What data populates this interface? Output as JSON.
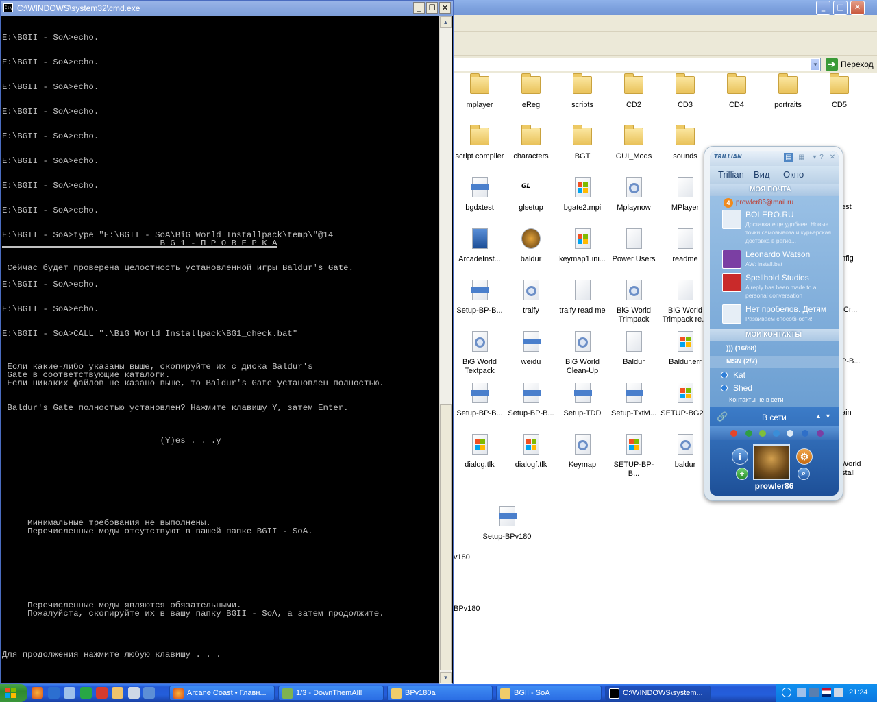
{
  "explorer": {
    "go_label": "Переход",
    "files": [
      {
        "label": "mplayer",
        "icon": "folder-icon"
      },
      {
        "label": "eReg",
        "icon": "folder-icon"
      },
      {
        "label": "scripts",
        "icon": "folder-icon"
      },
      {
        "label": "CD2",
        "icon": "folder-icon"
      },
      {
        "label": "CD3",
        "icon": "folder-icon"
      },
      {
        "label": "CD4",
        "icon": "folder-icon"
      },
      {
        "label": "portraits",
        "icon": "folder-icon"
      },
      {
        "label": "CD5",
        "icon": "folder-icon"
      },
      {
        "label": "script compiler",
        "icon": "folder-icon"
      },
      {
        "label": "characters",
        "icon": "folder-icon"
      },
      {
        "label": "BGT",
        "icon": "folder-icon"
      },
      {
        "label": "GUI_Mods",
        "icon": "folder-icon"
      },
      {
        "label": "sounds",
        "icon": "folder-icon"
      },
      {
        "label": "bgdxtest",
        "icon": "app-icon"
      },
      {
        "label": "glsetup",
        "icon": "opengl-icon"
      },
      {
        "label": "bgate2.mpi",
        "icon": "windows-file-icon"
      },
      {
        "label": "Mplaynow",
        "icon": "settings-file-icon"
      },
      {
        "label": "MPlayer",
        "icon": "document-icon"
      },
      {
        "label": "ArcadeInst...",
        "icon": "installer-icon"
      },
      {
        "label": "baldur",
        "icon": "baldur-icon"
      },
      {
        "label": "keymap1.ini...",
        "icon": "windows-file-icon"
      },
      {
        "label": "Power Users",
        "icon": "document-icon"
      },
      {
        "label": "readme",
        "icon": "document-icon"
      },
      {
        "label": "Setup-BP-B...",
        "icon": "app-icon"
      },
      {
        "label": "traify",
        "icon": "settings-file-icon"
      },
      {
        "label": "traify read me",
        "icon": "document-icon"
      },
      {
        "label": "BiG World Trimpack",
        "icon": "settings-file-icon"
      },
      {
        "label": "BiG World Trimpack re...",
        "icon": "document-icon"
      },
      {
        "label": "BiG World Textpack",
        "icon": "settings-file-icon"
      },
      {
        "label": "weidu",
        "icon": "app-icon"
      },
      {
        "label": "BiG World Clean-Up",
        "icon": "settings-file-icon"
      },
      {
        "label": "Baldur",
        "icon": "document-icon"
      },
      {
        "label": "Baldur.err",
        "icon": "windows-file-icon"
      },
      {
        "label": "Setup-BP-B...",
        "icon": "app-icon"
      },
      {
        "label": "Setup-BP-B...",
        "icon": "app-icon"
      },
      {
        "label": "Setup-TDD",
        "icon": "app-icon"
      },
      {
        "label": "Setup-TxtM...",
        "icon": "app-icon"
      },
      {
        "label": "SETUP-BG2...",
        "icon": "windows-file-icon"
      },
      {
        "label": "dialog.tlk",
        "icon": "windows-file-icon"
      },
      {
        "label": "dialogf.tlk",
        "icon": "windows-file-icon"
      },
      {
        "label": "Keymap",
        "icon": "settings-file-icon"
      },
      {
        "label": "SETUP-BP-B...",
        "icon": "windows-file-icon"
      },
      {
        "label": "baldur",
        "icon": "settings-file-icon"
      },
      {
        "label": "Setup-BPv180",
        "icon": "app-icon"
      }
    ],
    "partial_labels": [
      "est",
      "nfig",
      "tCr...",
      "P-B...",
      "ain",
      "World",
      "stall",
      "v180",
      "BPv180"
    ]
  },
  "trillian": {
    "logo": "TRILLIAN",
    "menu": [
      "Trillian",
      "Вид",
      "Окно"
    ],
    "section_mail": "МОЯ ПОЧТА",
    "mail_account": "prowler86@mail.ru",
    "mail_count": "4",
    "messages": [
      {
        "name": "BOLERO.RU",
        "text": "Доставка еще удобнее! Новые точки самовывоза и курьерская доставка в регио..."
      },
      {
        "name": "Leonardo Watson",
        "text": "AW: install.bat"
      },
      {
        "name": "Spellhold Studios",
        "text": "A reply has been made to a personal conversation"
      },
      {
        "name": "Нет пробелов. Детям",
        "text": "Развиваем способности!"
      }
    ],
    "section_contacts": "МОИ КОНТАКТЫ",
    "group_all": "))) (16/88)",
    "group_msn": "MSN (2/7)",
    "contacts": [
      "Kat",
      "Shed"
    ],
    "not_in_list": "Контакты не в сети",
    "status": "В сети",
    "username": "prowler86"
  },
  "cmd": {
    "title": "C:\\WINDOWS\\system32\\cmd.exe",
    "lines": [
      {
        "t": "E:\\BGII - SoA>echo."
      },
      {
        "t": "E:\\BGII - SoA>echo."
      },
      {
        "t": "E:\\BGII - SoA>echo."
      },
      {
        "t": "E:\\BGII - SoA>echo."
      },
      {
        "t": "E:\\BGII - SoA>echo."
      },
      {
        "t": "E:\\BGII - SoA>echo."
      },
      {
        "t": "E:\\BGII - SoA>echo."
      },
      {
        "t": "E:\\BGII - SoA>echo."
      },
      {
        "t": "E:\\BGII - SoA>type \"E:\\BGII - SoA\\BiG World Installpack\\temp\\\"@14"
      },
      {
        "t": "                               B G 1 - П Р О В Е Р К А"
      },
      {
        "t": " Сейчас будет проверена целостность установленной игры Baldur's Gate."
      },
      {
        "t": "E:\\BGII - SoA>echo."
      },
      {
        "t": "E:\\BGII - SoA>echo."
      },
      {
        "t": "E:\\BGII - SoA>CALL \".\\BiG World Installpack\\BG1_check.bat\""
      },
      {
        "t": " Если какие-либо указаны выше, скопируйте их с диска Baldur's"
      },
      {
        "t": " Gate в соответствующие каталоги."
      },
      {
        "t": " Если никаких файлов не казано выше, то Baldur's Gate установлен полностью."
      },
      {
        "t": " Baldur's Gate полностью установлен? Нажмите клавишу Y, затем Enter."
      },
      {
        "t": "                               (Y)es . . .y"
      },
      {
        "t": "     Минимальные требования не выполнены."
      },
      {
        "t": "     Перечисленные моды отсутствуют в вашей папке BGII - SoA."
      },
      {
        "t": "     Перечисленные моды являются обязательными."
      },
      {
        "t": "     Пожалуйста, скопируйте их в вашу папку BGII - SoA, а затем продолжите."
      },
      {
        "t": "Для продолжения нажмите любую клавишу . . ."
      }
    ]
  },
  "taskbar": {
    "start_icon": "windows-flag-icon",
    "buttons": [
      {
        "label": "Arcane Coast • Главн...",
        "icon": "firefox-icon"
      },
      {
        "label": "1/3 - DownThemAll!",
        "icon": "download-icon"
      },
      {
        "label": "BPv180a",
        "icon": "folder-icon"
      },
      {
        "label": "BGII - SoA",
        "icon": "folder-icon"
      },
      {
        "label": "C:\\WINDOWS\\system...",
        "icon": "cmd-icon"
      }
    ],
    "clock": "21:24"
  }
}
